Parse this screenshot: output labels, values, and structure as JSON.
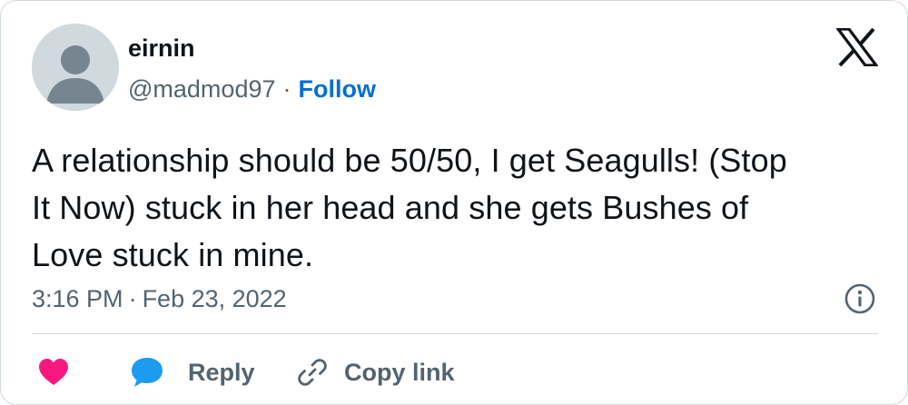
{
  "author": {
    "display_name": "eirnin",
    "handle": "@madmod97",
    "separator": "·",
    "follow_label": "Follow"
  },
  "tweet": {
    "text_lines": [
      "A relationship should be 50/50, I get Seagulls! (Stop",
      "It Now) stuck in her head and she gets Bushes of",
      "Love stuck in mine."
    ]
  },
  "meta": {
    "time": "3:16 PM",
    "separator": "·",
    "date": "Feb 23, 2022"
  },
  "actions": {
    "reply_label": "Reply",
    "copy_link_label": "Copy link"
  },
  "icons": {
    "platform": "x-logo-icon",
    "info": "info-icon",
    "like": "heart-icon",
    "reply": "speech-bubble-icon",
    "copy": "link-icon"
  },
  "colors": {
    "follow": "#006fd6",
    "heart": "#f91880",
    "reply": "#1d9bf0",
    "secondary_text": "#536471",
    "primary_text": "#0f1419",
    "avatar_bg": "#cfd9de"
  }
}
